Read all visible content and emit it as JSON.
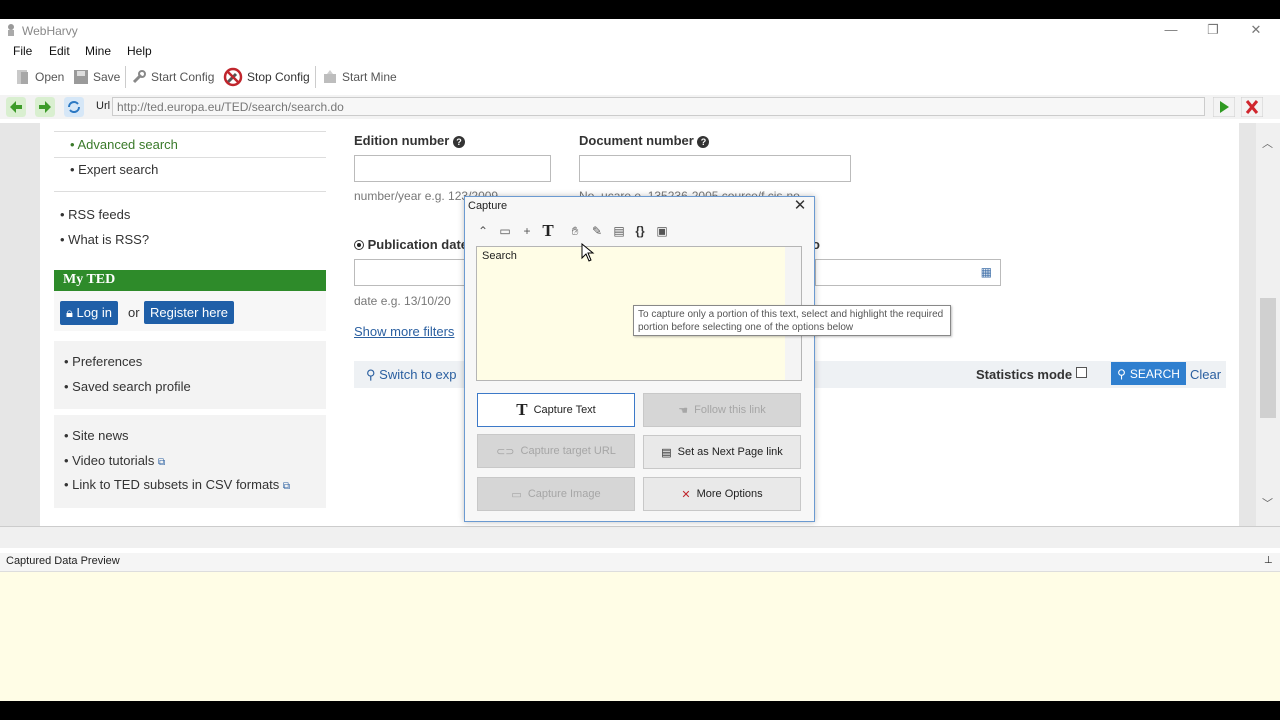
{
  "window": {
    "title": "WebHarvy",
    "minimize": "—",
    "restore": "❐",
    "close": "✕"
  },
  "menu": [
    "File",
    "Edit",
    "Mine",
    "Help"
  ],
  "toolbar": {
    "open": "Open",
    "save": "Save",
    "start_config": "Start Config",
    "stop_config": "Stop Config",
    "start_mine": "Start Mine"
  },
  "urlbar": {
    "label": "Url",
    "value": "http://ted.europa.eu/TED/search/search.do"
  },
  "page": {
    "sidebar": {
      "search_links": [
        "Advanced search",
        "Expert search"
      ],
      "rss_links": [
        "RSS feeds",
        "What is RSS?"
      ],
      "myted_title": "My TED",
      "login": "Log in",
      "or": "or",
      "register": "Register here",
      "profile_links": [
        "Preferences",
        "Saved search profile"
      ],
      "resource_links": [
        "Site news",
        "Video tutorials",
        "Link to TED subsets in CSV formats"
      ]
    },
    "form": {
      "edition_label": "Edition number",
      "document_label": "Document number",
      "edition_hint": "number/year e.g. 123/2009",
      "document_hint": "No_ucare e. 135236-2005 cource/f cis-no",
      "publication_label": "Publication date",
      "date_hint": "date e.g. 13/10/20",
      "show_more": "Show more filters",
      "switch_expert": "Switch to exp",
      "statistics_mode": "Statistics mode",
      "search_button": "SEARCH",
      "clear": "Clear"
    }
  },
  "capture_dialog": {
    "title": "Capture",
    "close": "✕",
    "preview_text": "Search",
    "tooltip": "To capture only a portion of this text, select and highlight the required portion before selecting one of the options below",
    "buttons": {
      "capture_text": "Capture Text",
      "follow_link": "Follow this link",
      "capture_url": "Capture target URL",
      "next_page": "Set as Next Page link",
      "capture_image": "Capture Image",
      "more_options": "More Options"
    },
    "tools": [
      "expand-collapse-icon",
      "html-icon",
      "add-icon",
      "text-icon",
      "hand-icon",
      "pencil-icon",
      "table-icon",
      "braces-icon",
      "window-icon"
    ]
  },
  "bottom_panel": {
    "title": "Captured Data Preview",
    "pin": "📌"
  }
}
